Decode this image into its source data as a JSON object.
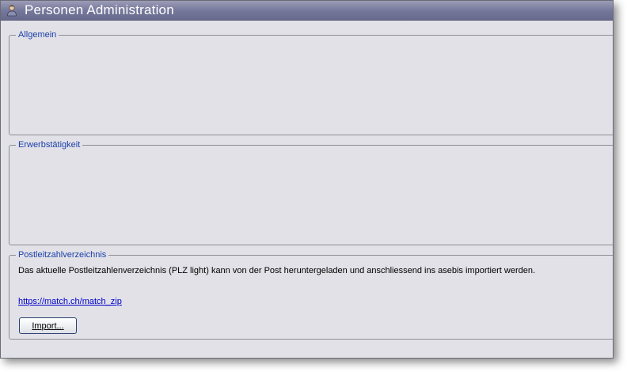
{
  "window": {
    "title": "Personen Administration",
    "icon": "person-icon"
  },
  "groups": {
    "allgemein": {
      "label": "Allgemein"
    },
    "erwerb": {
      "label": "Erwerbstätigkeit"
    },
    "plz": {
      "label": "Postleitzahlverzeichnis",
      "text": "Das aktuelle Postleitzahlenverzeichnis (PLZ light) kann von der Post heruntergeladen und anschliessend ins asebis importiert werden.",
      "link": "https://match.ch/match_zip",
      "button": "Import..."
    }
  },
  "colors": {
    "titlebar": "#74769a",
    "window_bg": "#e1e1e7",
    "legend": "#1c3fa8",
    "link": "#0000cc"
  }
}
